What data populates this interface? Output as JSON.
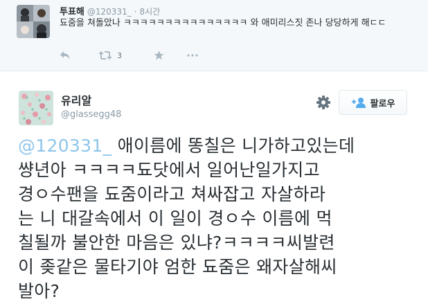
{
  "reply_tweet": {
    "display_name": "투표해",
    "handle": "@120331_",
    "separator": "·",
    "time": "8시간",
    "text": "됴줌을 쳐돌았나 ㅋㅋㅋㅋㅋㅋㅋㅋㅋㅋㅋㅋㅋㅋㅋ 와 애미리스짓 존나 당당하게 해ㄷㄷ",
    "retweet_count": "3",
    "icons": [
      "reply-icon",
      "retweet-icon",
      "favorite-icon",
      "more-icon"
    ]
  },
  "main_tweet": {
    "display_name": "유리알",
    "handle": "@glassegg48",
    "follow_label": "팔로우",
    "mention": "@120331_",
    "lines": [
      " 애이름에 똥칠은 니가하고있는데",
      "썅년아 ㅋㅋㅋㅋ됴닷에서 일어난일가지고",
      "경ㅇ수팬을 됴줌이라고 쳐싸잡고 자살하라",
      "는 니 대갈속에서 이 일이 경ㅇ수 이름에 먹",
      "칠될까 불안한 마음은 있냐?ㅋㅋㅋㅋ씨발련",
      "이 좆같은 물타기야 엄한 됴줌은 왜자살해씨",
      "발아?"
    ],
    "icons": [
      "gear-icon",
      "follow-person-plus-icon"
    ]
  },
  "colors": {
    "link": "#8ec5ea",
    "muted": "#8899a6",
    "text": "#292f33",
    "reply_bg": "#f5f8fa",
    "border": "#e1e8ed"
  }
}
